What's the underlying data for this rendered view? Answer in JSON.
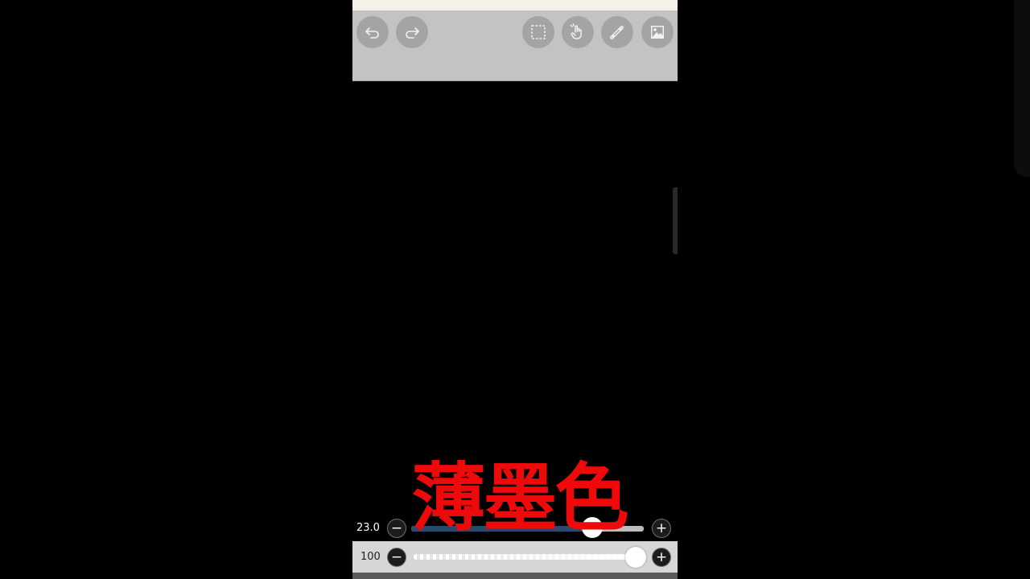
{
  "toolbar": {
    "buttons": [
      {
        "name": "undo",
        "icon": "undo-icon"
      },
      {
        "name": "redo",
        "icon": "redo-icon"
      },
      {
        "name": "selection",
        "icon": "selection-icon"
      },
      {
        "name": "hand",
        "icon": "hand-icon"
      },
      {
        "name": "ruler",
        "icon": "ruler-icon"
      },
      {
        "name": "material",
        "icon": "image-icon"
      }
    ]
  },
  "brush_size": {
    "value_label": "23.0",
    "minus_label": "−",
    "plus_label": "+",
    "level": 0.78
  },
  "opacity": {
    "value_label": "100",
    "minus_label": "−",
    "plus_label": "+",
    "level": 1.0
  },
  "caption": {
    "text": "薄墨色",
    "color": "#ee0a0a"
  },
  "colors": {
    "toolbar_bg": "#c3c3c3",
    "button_bg": "#a4a4a4",
    "size_track_fill": "#2b4a6b"
  }
}
